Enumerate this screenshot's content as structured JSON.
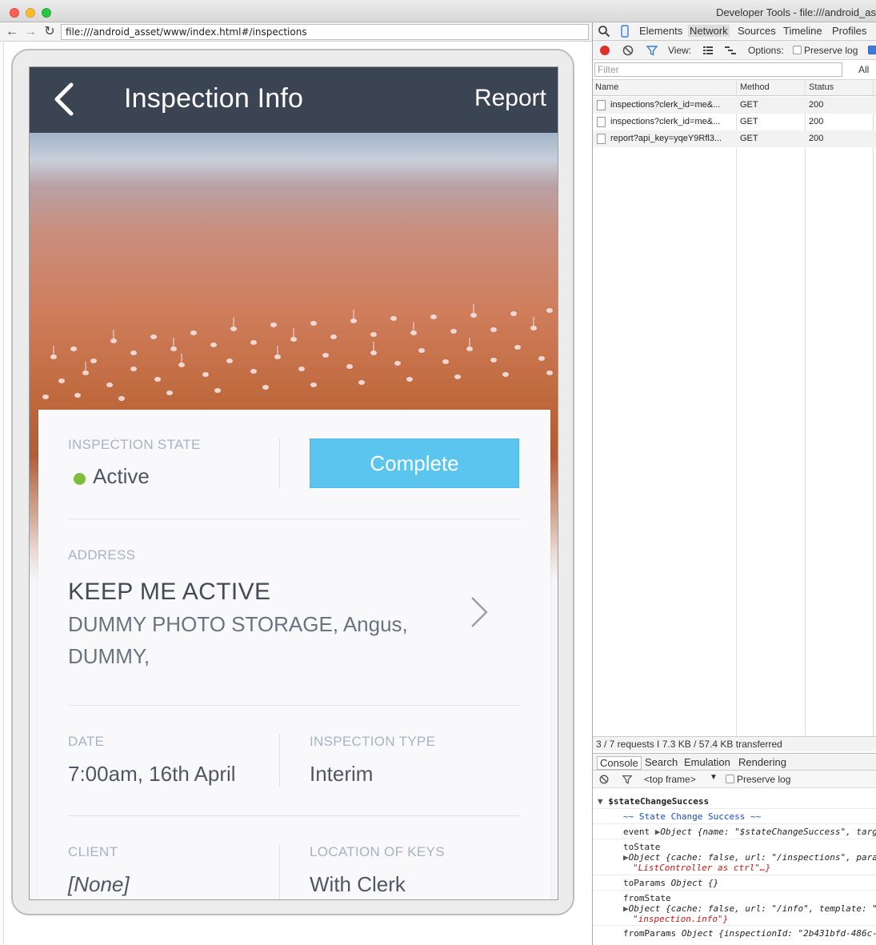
{
  "window": {
    "devtools_title": "Developer Tools - file:///android_as"
  },
  "browser": {
    "url": "file:///android_asset/www/index.html#/inspections"
  },
  "app": {
    "header": {
      "title": "Inspection Info",
      "report_label": "Report"
    },
    "card": {
      "state_label": "INSPECTION STATE",
      "state_value": "Active",
      "status_color": "#7dbe3b",
      "complete_label": "Complete",
      "address_label": "ADDRESS",
      "address_name": "KEEP ME ACTIVE",
      "address_line1": "DUMMY PHOTO STORAGE,  Angus,",
      "address_line2": "DUMMY,",
      "date_label": "DATE",
      "date_value": "7:00am, 16th April",
      "type_label": "INSPECTION TYPE",
      "type_value": "Interim",
      "client_label": "CLIENT",
      "client_value": "[None]",
      "keys_label": "LOCATION OF KEYS",
      "keys_value": "With Clerk"
    },
    "colors": {
      "header_bg": "#3b4452",
      "button_bg": "#5bc5ef",
      "label": "#a7b3c3"
    }
  },
  "devtools": {
    "tabs": [
      "Elements",
      "Network",
      "Sources",
      "Timeline",
      "Profiles"
    ],
    "active_tab": "Network",
    "toolbar": {
      "view_label": "View:",
      "options_label": "Options:",
      "preserve_log_label": "Preserve log"
    },
    "filter": {
      "placeholder": "Filter",
      "all_label": "All"
    },
    "table": {
      "columns": [
        "Name",
        "Method",
        "Status"
      ],
      "rows": [
        {
          "name": "inspections?clerk_id=me&...",
          "method": "GET",
          "status": "200"
        },
        {
          "name": "inspections?clerk_id=me&...",
          "method": "GET",
          "status": "200"
        },
        {
          "name": "report?api_key=yqeY9Rfl3...",
          "method": "GET",
          "status": "200"
        }
      ]
    },
    "summary": "3 / 7 requests  I  7.3 KB / 57.4 KB transferred",
    "drawer_tabs": [
      "Console",
      "Search",
      "Emulation",
      "Rendering"
    ],
    "console_toolbar": {
      "frame": "<top frame>",
      "preserve_log_label": "Preserve log"
    },
    "console": {
      "group_title": "$stateChangeSuccess",
      "banner": "~~ State Change Success ~~",
      "event_key": "event",
      "event_obj": "Object {name: \"$stateChangeSuccess\", targ",
      "to_state_key": "toState",
      "to_state_obj": "Object {cache: false, url: \"/inspections\", para",
      "to_state_cont": "\"ListController as ctrl\"…}",
      "to_params_key": "toParams",
      "to_params_obj": "Object {}",
      "from_state_key": "fromState",
      "from_state_obj": "Object {cache: false, url: \"/info\", template: \"",
      "from_state_cont": "\"inspection.info\"}",
      "from_params_key": "fromParams",
      "from_params_obj": "Object {inspectionId: \"2b431bfd-486c-"
    }
  }
}
